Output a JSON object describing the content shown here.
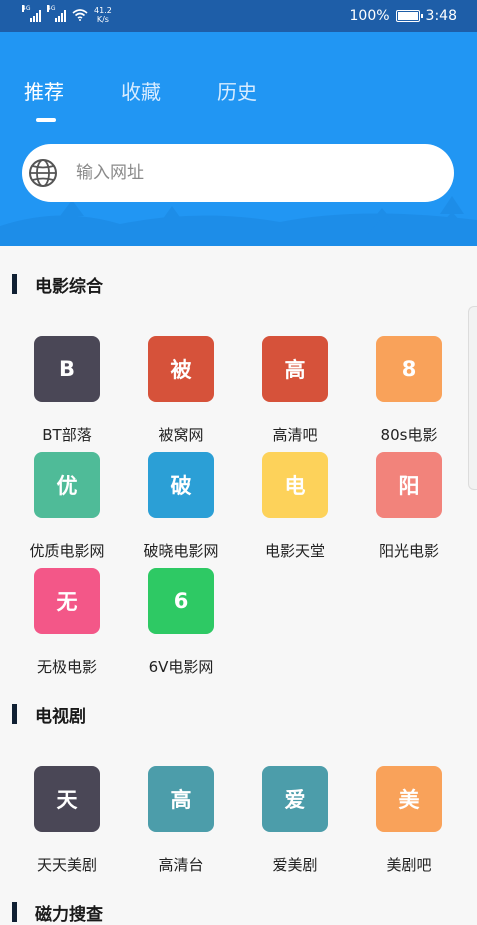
{
  "status_bar": {
    "signal1_tag": "4G",
    "signal2_tag": "4G",
    "net_speed_value": "41.2",
    "net_speed_unit": "K/s",
    "battery_percent": "100%",
    "battery_level": 1.0,
    "time": "3:48"
  },
  "tabs": [
    {
      "label": "推荐"
    },
    {
      "label": "收藏"
    },
    {
      "label": "历史"
    }
  ],
  "search": {
    "placeholder": "输入网址",
    "icon": "globe-icon"
  },
  "sections": {
    "movies": {
      "title": "电影综合",
      "items": [
        {
          "glyph": "B",
          "label": "BT部落",
          "color": "#4a4756"
        },
        {
          "glyph": "被",
          "label": "被窝网",
          "color": "#d6523a"
        },
        {
          "glyph": "高",
          "label": "高清吧",
          "color": "#d6523a"
        },
        {
          "glyph": "8",
          "label": "80s电影",
          "color": "#f9a25a"
        },
        {
          "glyph": "优",
          "label": "优质电影网",
          "color": "#4fbb98"
        },
        {
          "glyph": "破",
          "label": "破晓电影网",
          "color": "#2b9fd6"
        },
        {
          "glyph": "电",
          "label": "电影天堂",
          "color": "#fdd25a"
        },
        {
          "glyph": "阳",
          "label": "阳光电影",
          "color": "#f2837b"
        },
        {
          "glyph": "无",
          "label": "无极电影",
          "color": "#f35788"
        },
        {
          "glyph": "6",
          "label": "6V电影网",
          "color": "#2ec964"
        }
      ]
    },
    "tv": {
      "title": "电视剧",
      "items": [
        {
          "glyph": "天",
          "label": "天天美剧",
          "color": "#4a4756"
        },
        {
          "glyph": "高",
          "label": "高清台",
          "color": "#4c9daa"
        },
        {
          "glyph": "爱",
          "label": "爱美剧",
          "color": "#4c9daa"
        },
        {
          "glyph": "美",
          "label": "美剧吧",
          "color": "#f9a25a"
        }
      ]
    },
    "magnet": {
      "title": "磁力搜查"
    }
  }
}
